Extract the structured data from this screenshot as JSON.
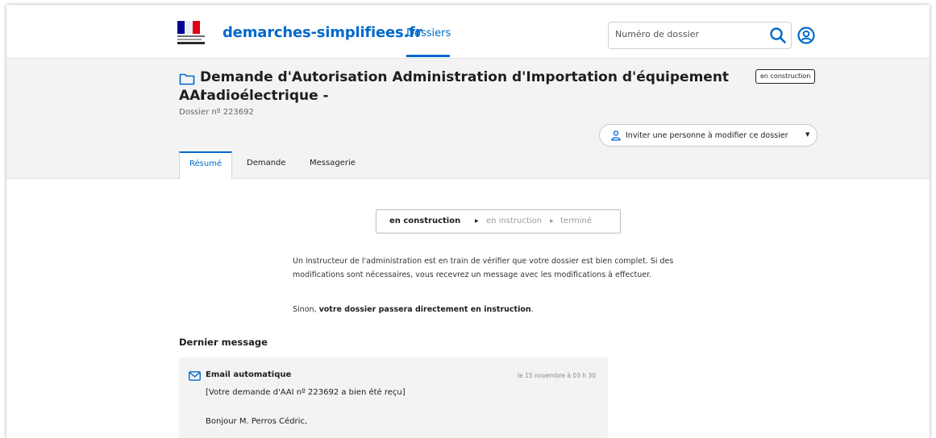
{
  "header": {
    "brand": "demarches-simplifiees.fr",
    "nav_dossiers": "Dossiers",
    "search_placeholder": "Numéro de dossier"
  },
  "dossier": {
    "title_line1": "Demande d'Autorisation Administration d'Importation d'équipement radioélectrique -",
    "title_line2": "AAI",
    "status_badge": "en construction",
    "number": "Dossier nº 223692",
    "invite_label": "Inviter une personne à modifier ce dossier"
  },
  "tabs": [
    {
      "label": "Résumé",
      "active": true
    },
    {
      "label": "Demande",
      "active": false
    },
    {
      "label": "Messagerie",
      "active": false
    }
  ],
  "stepper": {
    "current": "en construction",
    "next": "en instruction",
    "last": "terminé"
  },
  "explanation": {
    "paragraph1": "Un instructeur de l'administration est en train de vérifier que votre dossier est bien complet. Si des modifications sont nécessaires, vous recevrez un message avec les modifications à effectuer.",
    "paragraph2_prefix": "Sinon, ",
    "paragraph2_bold": "votre dossier passera directement en instruction",
    "paragraph2_suffix": "."
  },
  "last_message": {
    "section_title": "Dernier message",
    "from": "Email automatique",
    "date": "le 15 novembre à 03 h 30",
    "subject": "[Votre demande d'AAI nº 223692 a bien été reçu]",
    "greeting": "Bonjour M. Perros Cédric,"
  },
  "colors": {
    "accent": "#0069cc",
    "band_bg": "#f3f3f3"
  },
  "icons": {
    "search": "search-icon",
    "user": "user-circle-icon",
    "folder": "folder-icon",
    "person": "person-icon",
    "mail": "mail-icon"
  }
}
